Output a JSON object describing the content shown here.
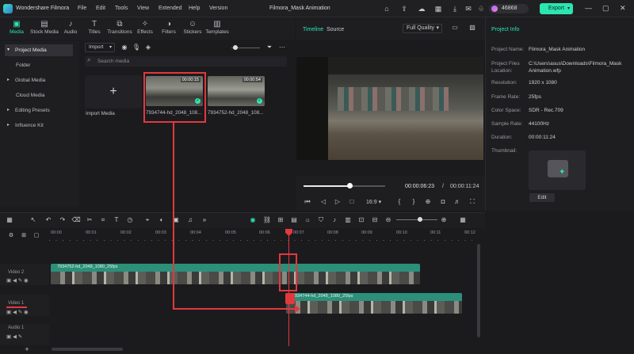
{
  "app": {
    "name": "Wondershare Filmora",
    "doc_title": "Filmora_Mask Animation",
    "credits": "46868",
    "export_label": "Export"
  },
  "menu": [
    "File",
    "Edit",
    "Tools",
    "View",
    "Extended",
    "Help",
    "Version"
  ],
  "toolbar_tabs": [
    {
      "label": "Media",
      "icon": "media-icon",
      "active": true
    },
    {
      "label": "Stock Media",
      "icon": "stock-media-icon"
    },
    {
      "label": "Audio",
      "icon": "audio-icon"
    },
    {
      "label": "Titles",
      "icon": "titles-icon"
    },
    {
      "label": "Transitions",
      "icon": "transitions-icon"
    },
    {
      "label": "Effects",
      "icon": "effects-icon"
    },
    {
      "label": "Filters",
      "icon": "filters-icon"
    },
    {
      "label": "Stickers",
      "icon": "stickers-icon"
    },
    {
      "label": "Templates",
      "icon": "templates-icon"
    }
  ],
  "sidebar": [
    "Project Media",
    "Folder",
    "Global Media",
    "Cloud Media",
    "Editing Presets",
    "Influence Kit"
  ],
  "media": {
    "import_label": "Import",
    "search_placeholder": "Search media",
    "import_tile_label": "Import Media",
    "clips": [
      {
        "name": "7934744-hd_2048_108...",
        "duration": "00:00:15"
      },
      {
        "name": "7934752-hd_2048_108...",
        "duration": "00:00:54"
      }
    ]
  },
  "preview": {
    "tab_timeline": "Timeline",
    "tab_source": "Source",
    "quality": "Full Quality",
    "current_time": "00:00:06:23",
    "separator": "/",
    "total_time": "00:00:11:24",
    "aspect": "16:9",
    "progress": 0.55
  },
  "project_info": {
    "header": "Project Info",
    "rows": [
      {
        "key": "Project Name:",
        "value": "Filmora_Mask Animation"
      },
      {
        "key": "Project Files\nLocation:",
        "value": "C:\\Users\\asus\\Downloads\\Filmora_Mask\nAnimation.wfp"
      },
      {
        "key": "Resolution:",
        "value": "1920 x 1080"
      },
      {
        "key": "Frame Rate:",
        "value": "25fps"
      },
      {
        "key": "Color Space:",
        "value": "SDR - Rec.709"
      },
      {
        "key": "Sample Rate:",
        "value": "44100Hz"
      },
      {
        "key": "Duration:",
        "value": "00:00:11:24"
      },
      {
        "key": "Thumbnail:",
        "value": ""
      }
    ],
    "edit_label": "Edit"
  },
  "timeline": {
    "ruler": [
      "00:00",
      "00:01",
      "00:02",
      "00:03",
      "00:04",
      "00:05",
      "00:06",
      "00:07",
      "00:08",
      "00:09",
      "00:10",
      "00:11",
      "00:12"
    ],
    "tracks": [
      {
        "name": "Video 2",
        "clip": "7934752-hd_2048_1080_25fps"
      },
      {
        "name": "Video 1",
        "clip": "7934744-hd_2048_1080_25fps"
      },
      {
        "name": "Audio 1",
        "clip": ""
      }
    ]
  },
  "colors": {
    "accent": "#2ce5b0",
    "annotation_red": "#e0393e",
    "clip_green": "#2c8f7a"
  }
}
